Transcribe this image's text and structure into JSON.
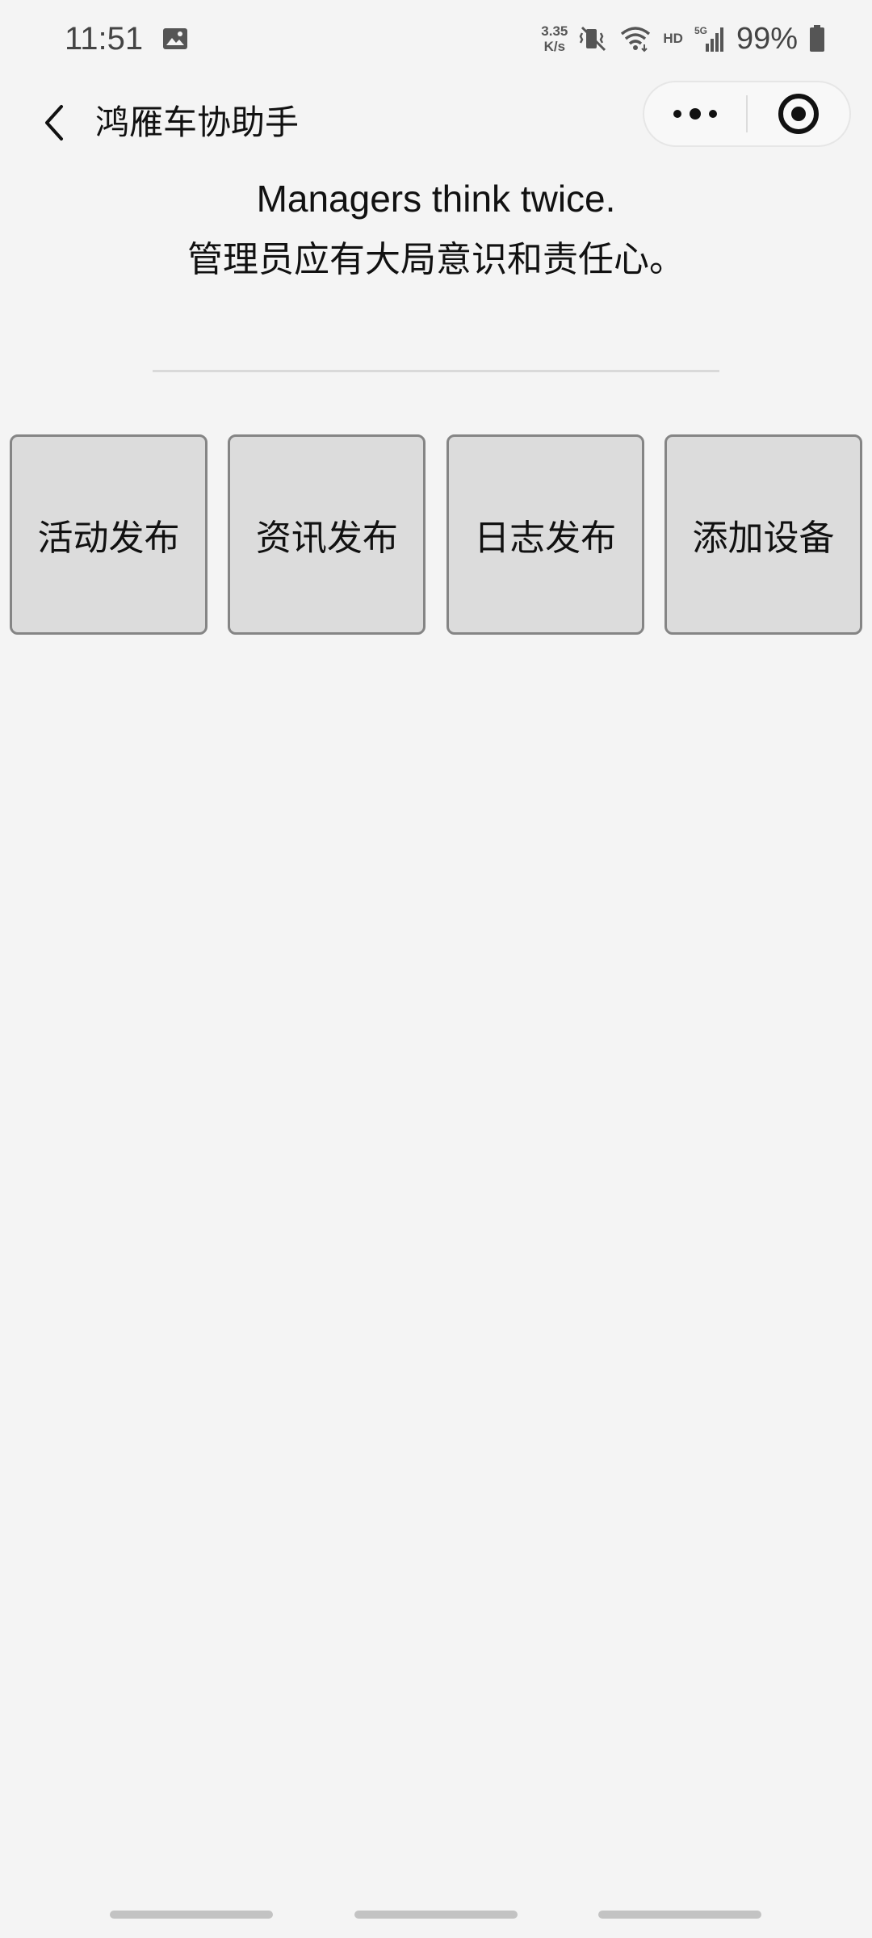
{
  "status_bar": {
    "time": "11:51",
    "net_speed_value": "3.35",
    "net_speed_unit": "K/s",
    "hd_label": "HD",
    "network_label": "5G",
    "battery_percent": "99%",
    "icons": [
      "gallery-icon",
      "mute-vibrate-icon",
      "wifi-icon",
      "signal-icon",
      "battery-icon"
    ]
  },
  "nav_bar": {
    "title": "鸿雁车协助手",
    "back_icon": "chevron-left-icon",
    "more_icon": "more-dots-icon",
    "close_icon": "target-circle-icon"
  },
  "motto": {
    "english": "Managers think twice.",
    "chinese": "管理员应有大局意识和责任心。"
  },
  "actions": [
    {
      "label": "活动发布"
    },
    {
      "label": "资讯发布"
    },
    {
      "label": "日志发布"
    },
    {
      "label": "添加设备"
    }
  ],
  "colors": {
    "background": "#f4f4f4",
    "button_fill": "#dcdcdc",
    "button_border": "#858585",
    "divider": "#d9d9d9"
  }
}
